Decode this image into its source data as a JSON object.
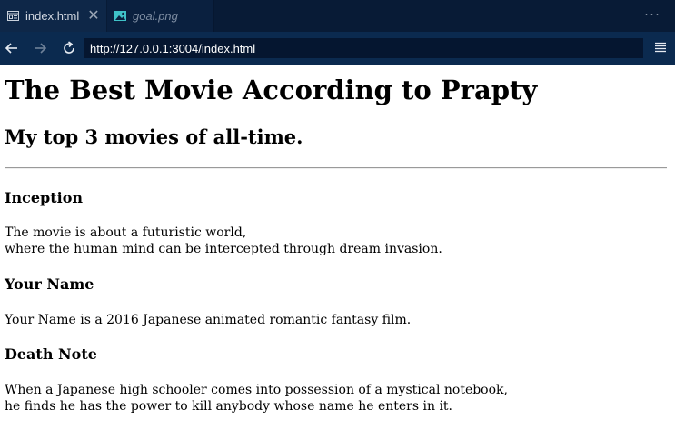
{
  "tabs": [
    {
      "label": "index.html",
      "close": "✕",
      "icon": "file-code-icon"
    },
    {
      "label": "goal.png",
      "icon": "image-icon"
    }
  ],
  "more_actions_label": "···",
  "address_bar": {
    "url": "http://127.0.0.1:3004/index.html"
  },
  "page": {
    "h1": "The Best Movie According to Prapty",
    "h2": "My top 3 movies of all-time.",
    "movies": [
      {
        "title": "Inception",
        "desc_lines": [
          "The movie is about a futuristic world,",
          "where the human mind can be intercepted through dream invasion."
        ]
      },
      {
        "title": "Your Name",
        "desc_lines": [
          "Your Name is a 2016 Japanese animated romantic fantasy film."
        ]
      },
      {
        "title": "Death Note",
        "desc_lines": [
          "When a Japanese high schooler comes into possession of a mystical notebook,",
          "he finds he has the power to kill anybody whose name he enters in it."
        ]
      }
    ]
  },
  "colors": {
    "tab_bar_bg": "#081b36",
    "nav_bar_bg": "#0b2a4f",
    "url_bar_bg": "#051630",
    "image_icon_accent": "#3fc2c9"
  }
}
